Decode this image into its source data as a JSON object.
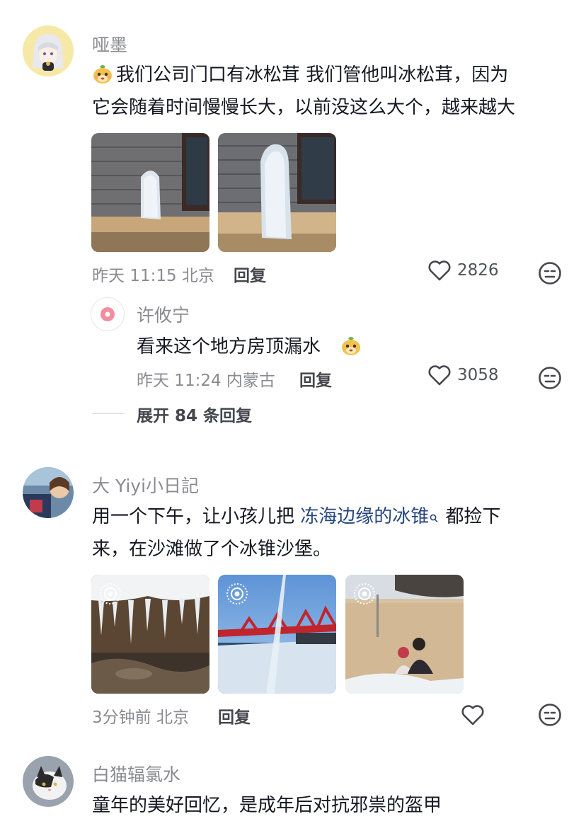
{
  "comments": [
    {
      "username": "哑墨",
      "text_line1": "我们公司门口有冰松茸  我们管他叫冰松茸，因为",
      "text_line2": "它会随着时间慢慢长大，以前没这么大个，越来越大",
      "time": "昨天 11:15 北京",
      "reply_label": "回复",
      "likes": "2826",
      "reply": {
        "username": "许攸宁",
        "text": "看来这个地方房顶漏水",
        "time": "昨天 11:24 内蒙古",
        "reply_label": "回复",
        "likes": "3058"
      },
      "expand_label": "展开 84 条回复"
    },
    {
      "username": "大 Yiyi小日記",
      "text_line1_pre": "用一个下午，让小孩儿把 ",
      "link": "冻海边缘的冰锥",
      "text_line1_post": " 都捡下",
      "text_line2": "来，在沙滩做了个冰锥沙堡。",
      "time": "3分钟前 北京",
      "reply_label": "回复"
    },
    {
      "username": "白猫辐氯水",
      "text_line1": "童年的美好回忆，是成年后对抗邪祟的盔甲"
    }
  ],
  "icons": {
    "like": "heart-outline-icon",
    "dislike": "meh-face-icon",
    "emoji": "mushroom-emoji-icon",
    "search": "search-icon",
    "live": "live-photo-icon"
  }
}
